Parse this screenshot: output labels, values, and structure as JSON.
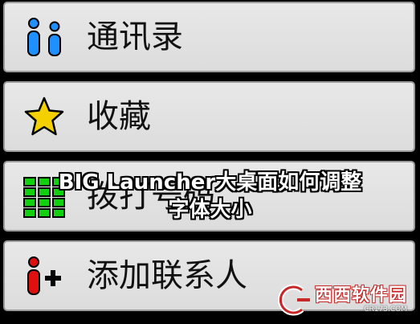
{
  "menu": {
    "items": [
      {
        "label": "通讯录",
        "icon": "contacts-icon"
      },
      {
        "label": "收藏",
        "icon": "star-icon"
      },
      {
        "label": "拨打号码",
        "icon": "dialpad-icon"
      },
      {
        "label": "添加联系人",
        "icon": "add-contact-icon"
      }
    ]
  },
  "overlay": {
    "line1": "BIG Launcher大桌面如何调整",
    "line2": "字体大小"
  },
  "colors": {
    "person_blue": "#1e90ff",
    "person_red": "#e01010",
    "star_yellow": "#f5d000",
    "keypad_green": "#10d010"
  }
}
